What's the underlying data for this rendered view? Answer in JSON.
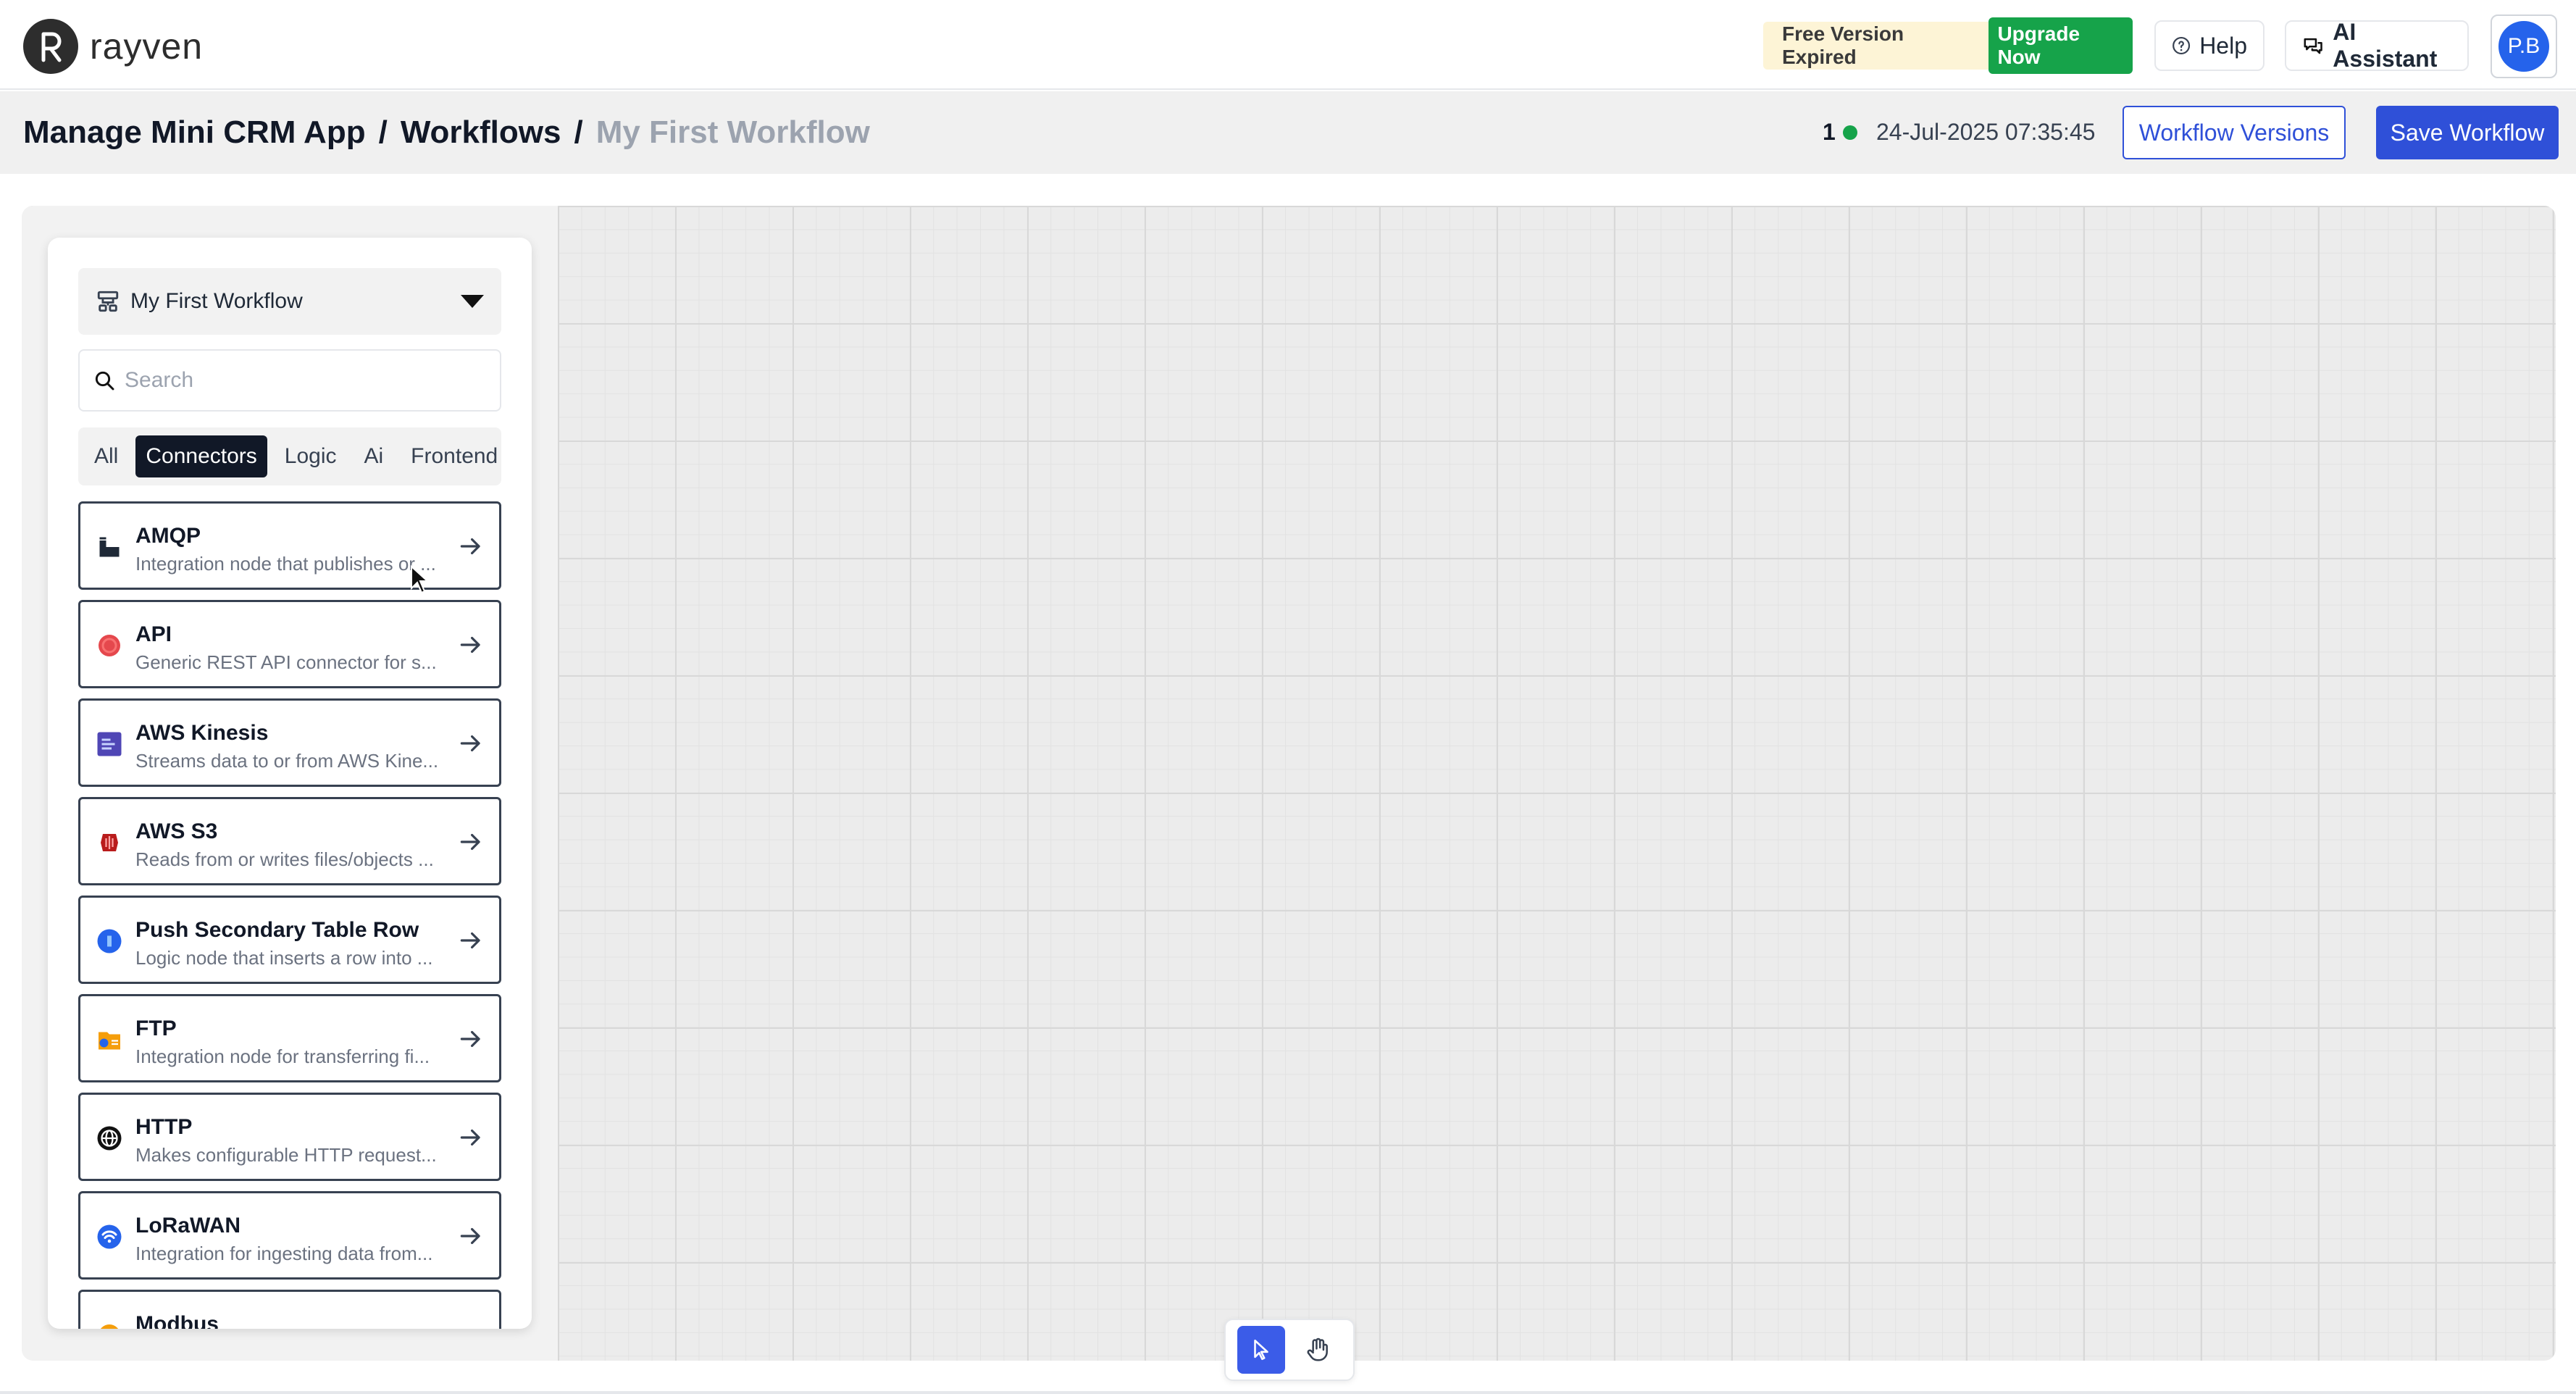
{
  "app": {
    "name": "rayven"
  },
  "banner": {
    "text": "Free Version Expired",
    "upgrade_label": "Upgrade Now"
  },
  "topbar": {
    "help_label": "Help",
    "ai_label": "AI Assistant",
    "avatar_initials": "P.B"
  },
  "breadcrumb": {
    "part1": "Manage Mini CRM App",
    "sep1": "/",
    "part2": "Workflows",
    "sep2": "/",
    "current": "My First Workflow"
  },
  "status": {
    "count": "1",
    "timestamp": "24-Jul-2025 07:35:45"
  },
  "actions": {
    "versions_label": "Workflow Versions",
    "save_label": "Save Workflow"
  },
  "panel": {
    "workflow_select": "My First Workflow",
    "search_placeholder": "Search",
    "tabs": [
      {
        "label": "All",
        "active": false
      },
      {
        "label": "Connectors",
        "active": true
      },
      {
        "label": "Logic",
        "active": false
      },
      {
        "label": "Ai",
        "active": false
      },
      {
        "label": "Frontend",
        "active": false
      }
    ],
    "items": [
      {
        "title": "AMQP",
        "desc": "Integration node that publishes or ...",
        "icon": "amqp-icon",
        "color": "#1f2937"
      },
      {
        "title": "API",
        "desc": "Generic REST API connector for s...",
        "icon": "api-icon",
        "color": "#e5484d"
      },
      {
        "title": "AWS Kinesis",
        "desc": "Streams data to or from AWS Kine...",
        "icon": "aws-kinesis-icon",
        "color": "#4f46b5"
      },
      {
        "title": "AWS S3",
        "desc": "Reads from or writes files/objects ...",
        "icon": "aws-s3-icon",
        "color": "#b91c1c"
      },
      {
        "title": "Push Secondary Table Row",
        "desc": "Logic node that inserts a row into ...",
        "icon": "table-row-icon",
        "color": "#2563eb"
      },
      {
        "title": "FTP",
        "desc": "Integration node for transferring fi...",
        "icon": "ftp-icon",
        "color": "#f59e0b"
      },
      {
        "title": "HTTP",
        "desc": "Makes configurable HTTP request...",
        "icon": "http-icon",
        "color": "#111111"
      },
      {
        "title": "LoRaWAN",
        "desc": "Integration for ingesting data from...",
        "icon": "lorawan-icon",
        "color": "#2563eb"
      },
      {
        "title": "Modbus",
        "desc": "",
        "icon": "modbus-icon",
        "color": "#f59e0b"
      }
    ]
  },
  "colors": {
    "primary": "#2f50d8",
    "success": "#16a34a",
    "dark": "#111827"
  }
}
